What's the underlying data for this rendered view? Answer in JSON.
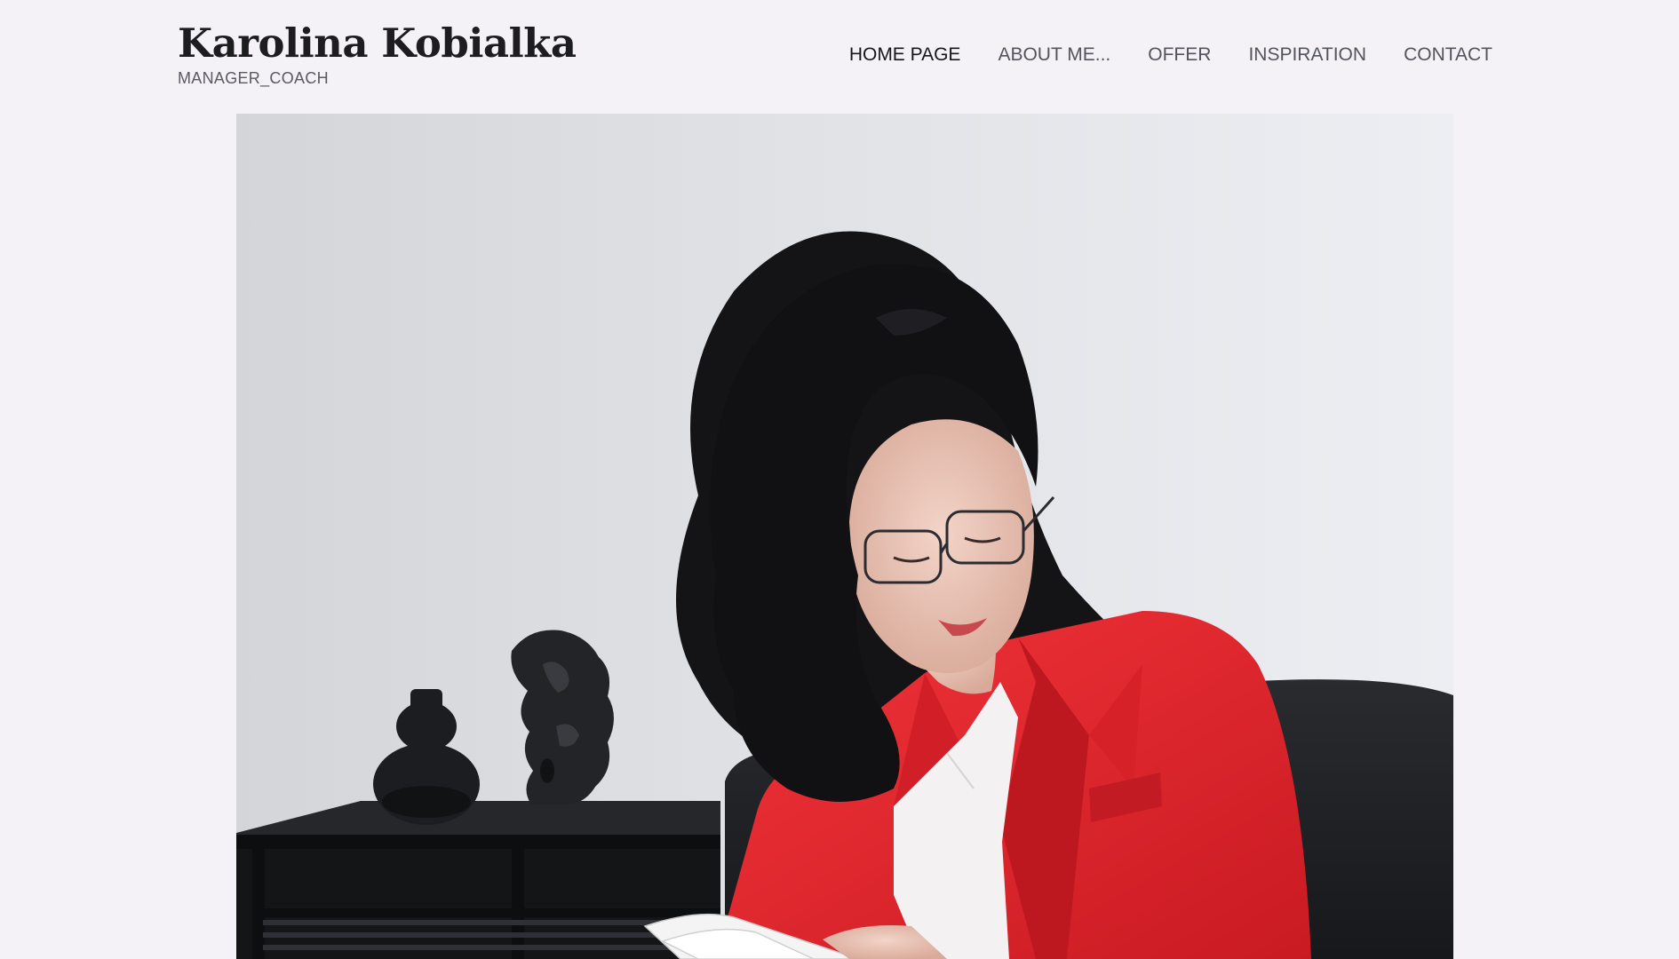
{
  "site": {
    "title": "Karolina Kobialka",
    "tagline": "MANAGER_COACH"
  },
  "nav": {
    "items": [
      {
        "label": "HOME PAGE",
        "active": true
      },
      {
        "label": "ABOUT ME...",
        "active": false
      },
      {
        "label": "OFFER",
        "active": false
      },
      {
        "label": "INSPIRATION",
        "active": false
      },
      {
        "label": "CONTACT",
        "active": false
      }
    ]
  },
  "hero": {
    "image": "portrait-photo",
    "colors": {
      "wall": "#e3e5ea",
      "blazer": "#e6232b",
      "hair": "#141416",
      "furniture": "#1e1f22"
    }
  }
}
